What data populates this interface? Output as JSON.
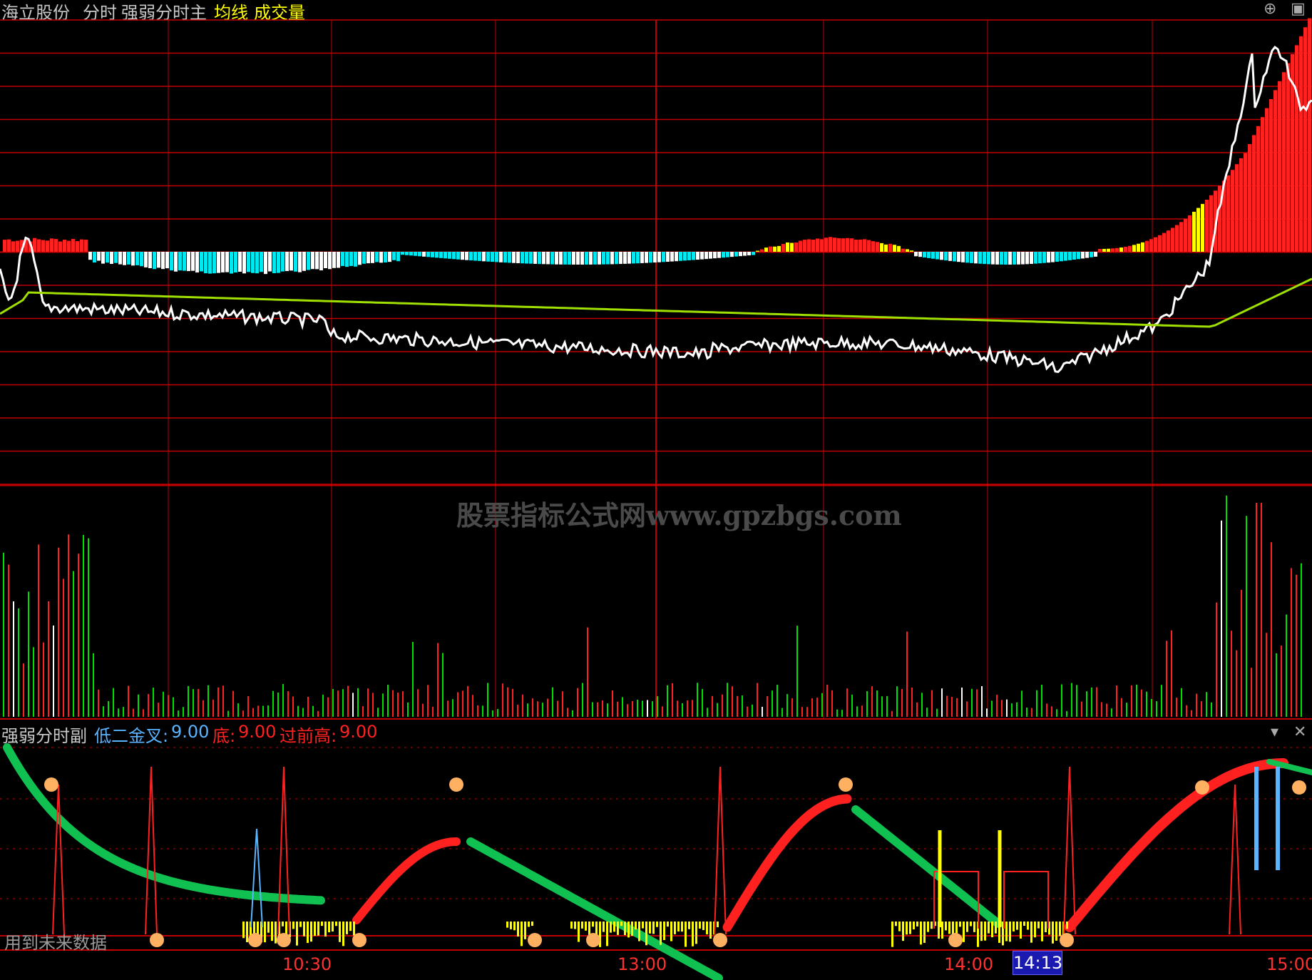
{
  "header": {
    "stock_name": "海立股份",
    "mode": "分时",
    "indicator_main": "强弱分时主",
    "avg_line_label": "均线",
    "volume_label": "成交量"
  },
  "sub_panel": {
    "title": "强弱分时副",
    "items": [
      {
        "label": "低二金叉:",
        "value": "9.00",
        "color": "#5ab4ff"
      },
      {
        "label": "底:",
        "value": "9.00",
        "color": "#ff2020"
      },
      {
        "label": "过前高:",
        "value": "9.00",
        "color": "#ff2020"
      }
    ],
    "note": "用到未来数据"
  },
  "time_axis": {
    "labels": [
      "10:30",
      "13:00",
      "14:00",
      "15:00"
    ],
    "cursor_time": "14:13"
  },
  "watermark": "股票指标公式网www.gpzbgs.com",
  "colors": {
    "grid": "#c00000",
    "price": "#ffffff",
    "avg": "#a0e000",
    "up": "#ff2020",
    "down": "#00e000",
    "cyan": "#00e8f0",
    "yellow": "#ffff00"
  }
}
